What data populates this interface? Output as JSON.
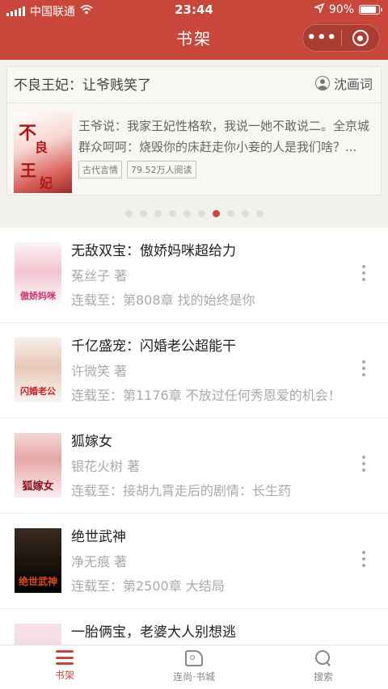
{
  "status_bar": {
    "carrier": "中国联通",
    "time": "23:44",
    "battery": "90%",
    "battery_level": 0.9
  },
  "header": {
    "title": "书架",
    "more_label": "•••"
  },
  "featured": {
    "title": "不良王妃：让爷贱笑了",
    "author": "沈画词",
    "description": "王爷说：我家王妃性格软，我说一她不敢说二。全京城群众呵呵：烧毁你的床赶走你小妾的人是我们啥？...",
    "tags": [
      "古代言情",
      "79.52万人阅读"
    ],
    "cover_text": "不良王妃",
    "dots_total": 10,
    "dots_active_index": 6
  },
  "books": [
    {
      "title": "无敌双宝：傲娇妈咪超给力",
      "author": "菟丝子 著",
      "progress": "连载至：第808章 找的始终是你",
      "cover_text": "傲娇妈咪超给力"
    },
    {
      "title": "千亿盛宠：闪婚老公超能干",
      "author": "许微笑 著",
      "progress": "连载至：第1176章 不放过任何秀恩爱的机会！",
      "cover_text": "闪婚老公超能干"
    },
    {
      "title": "狐嫁女",
      "author": "银花火树 著",
      "progress": "连载至：接胡九霄走后的剧情：长生药",
      "cover_text": "狐嫁女"
    },
    {
      "title": "绝世武神",
      "author": "净无痕 著",
      "progress": "连载至：第2500章 大结局",
      "cover_text": "绝世武神"
    },
    {
      "title": "一胎俩宝，老婆大人别想逃",
      "author": "",
      "progress": "",
      "cover_text": ""
    }
  ],
  "tabbar": [
    {
      "label": "书架",
      "icon": "bookshelf-icon",
      "active": true
    },
    {
      "label": "连尚·书城",
      "icon": "bookstore-icon",
      "active": false
    },
    {
      "label": "搜索",
      "icon": "search-icon",
      "active": false
    }
  ],
  "colors": {
    "accent": "#c8473a"
  }
}
